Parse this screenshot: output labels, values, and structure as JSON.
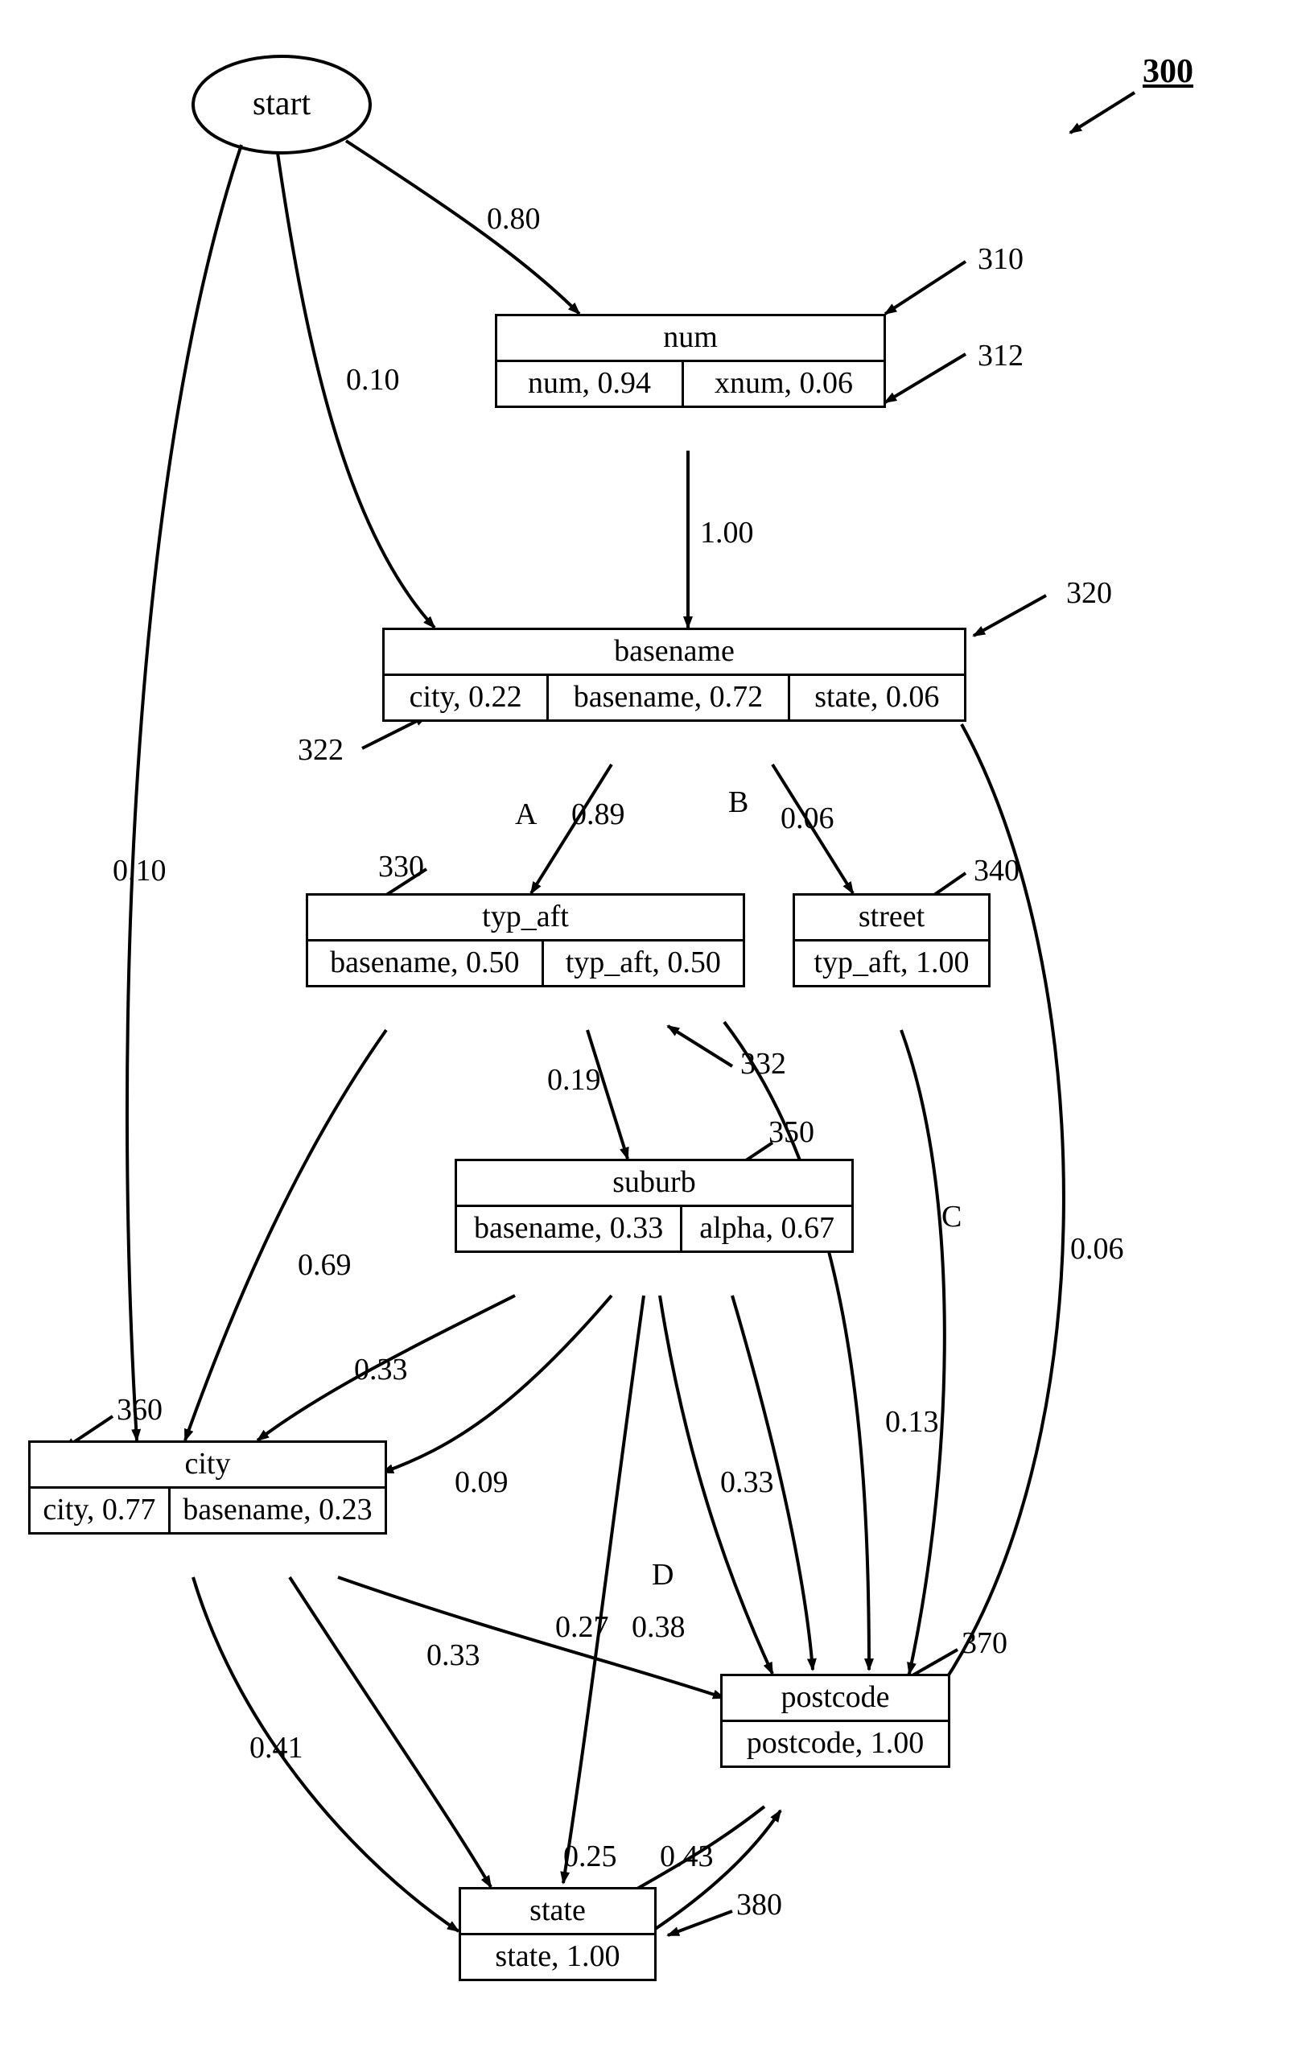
{
  "refs": {
    "r300": "300",
    "r310": "310",
    "r312": "312",
    "r320": "320",
    "r322": "322",
    "r330": "330",
    "r332": "332",
    "r340": "340",
    "r350": "350",
    "r360": "360",
    "r370": "370",
    "r380": "380"
  },
  "nodes": {
    "start": {
      "label": "start"
    },
    "num": {
      "label": "num",
      "cells": [
        "num, 0.94",
        "xnum, 0.06"
      ]
    },
    "basename": {
      "label": "basename",
      "cells": [
        "city, 0.22",
        "basename, 0.72",
        "state, 0.06"
      ]
    },
    "typaft": {
      "label": "typ_aft",
      "cells": [
        "basename, 0.50",
        "typ_aft, 0.50"
      ]
    },
    "street": {
      "label": "street",
      "cells": [
        "typ_aft, 1.00"
      ]
    },
    "suburb": {
      "label": "suburb",
      "cells": [
        "basename, 0.33",
        "alpha, 0.67"
      ]
    },
    "city": {
      "label": "city",
      "cells": [
        "city, 0.77",
        "basename, 0.23"
      ]
    },
    "postcode": {
      "label": "postcode",
      "cells": [
        "postcode, 1.00"
      ]
    },
    "state": {
      "label": "state",
      "cells": [
        "state, 1.00"
      ]
    }
  },
  "letters": {
    "A": "A",
    "B": "B",
    "C": "C",
    "D": "D"
  },
  "edges": {
    "start_num": "0.80",
    "start_basename": "0.10",
    "start_city": "0.10",
    "num_basename": "1.00",
    "basename_typaft": "0.89",
    "basename_street": "0.06",
    "basename_postcode": "0.06",
    "typaft_suburb": "0.19",
    "typaft_city": "0.69",
    "typaft_postcode": "0.13",
    "suburb_city_a": "0.33",
    "suburb_city_b": "0.09",
    "suburb_postcode": "0.33",
    "suburb_state": "0.27",
    "city_postcode": "0.38",
    "city_state_a": "0.33",
    "city_state_b": "0.41",
    "postcode_state": "0.25",
    "state_postcode": "0.43"
  },
  "chart_data": {
    "type": "state-diagram",
    "title": "300",
    "nodes": [
      {
        "id": "start",
        "emissions": []
      },
      {
        "id": "num",
        "ref": 310,
        "emissions": [
          {
            "sym": "num",
            "p": 0.94
          },
          {
            "sym": "xnum",
            "p": 0.06
          }
        ],
        "emissions_ref": 312
      },
      {
        "id": "basename",
        "ref": 320,
        "emissions": [
          {
            "sym": "city",
            "p": 0.22
          },
          {
            "sym": "basename",
            "p": 0.72
          },
          {
            "sym": "state",
            "p": 0.06
          }
        ],
        "emissions_ref": 322
      },
      {
        "id": "typ_aft",
        "ref": 330,
        "emissions": [
          {
            "sym": "basename",
            "p": 0.5
          },
          {
            "sym": "typ_aft",
            "p": 0.5
          }
        ],
        "emissions_ref": 332
      },
      {
        "id": "street",
        "ref": 340,
        "emissions": [
          {
            "sym": "typ_aft",
            "p": 1.0
          }
        ]
      },
      {
        "id": "suburb",
        "ref": 350,
        "emissions": [
          {
            "sym": "basename",
            "p": 0.33
          },
          {
            "sym": "alpha",
            "p": 0.67
          }
        ]
      },
      {
        "id": "city",
        "ref": 360,
        "emissions": [
          {
            "sym": "city",
            "p": 0.77
          },
          {
            "sym": "basename",
            "p": 0.23
          }
        ]
      },
      {
        "id": "postcode",
        "ref": 370,
        "emissions": [
          {
            "sym": "postcode",
            "p": 1.0
          }
        ]
      },
      {
        "id": "state",
        "ref": 380,
        "emissions": [
          {
            "sym": "state",
            "p": 1.0
          }
        ]
      }
    ],
    "edges": [
      {
        "from": "start",
        "to": "num",
        "p": 0.8
      },
      {
        "from": "start",
        "to": "basename",
        "p": 0.1
      },
      {
        "from": "start",
        "to": "city",
        "p": 0.1
      },
      {
        "from": "num",
        "to": "basename",
        "p": 1.0
      },
      {
        "from": "basename",
        "to": "typ_aft",
        "p": 0.89,
        "tag": "A"
      },
      {
        "from": "basename",
        "to": "street",
        "p": 0.06,
        "tag": "B"
      },
      {
        "from": "basename",
        "to": "postcode",
        "p": 0.06
      },
      {
        "from": "typ_aft",
        "to": "suburb",
        "p": 0.19
      },
      {
        "from": "typ_aft",
        "to": "city",
        "p": 0.69
      },
      {
        "from": "typ_aft",
        "to": "postcode",
        "p": 0.13
      },
      {
        "from": "street",
        "to": "postcode",
        "tag": "C"
      },
      {
        "from": "suburb",
        "to": "city",
        "p": 0.33
      },
      {
        "from": "suburb",
        "to": "city",
        "p": 0.09
      },
      {
        "from": "suburb",
        "to": "postcode",
        "p": 0.33
      },
      {
        "from": "suburb",
        "to": "state",
        "p": 0.27
      },
      {
        "from": "city",
        "to": "postcode",
        "p": 0.38,
        "tag": "D"
      },
      {
        "from": "city",
        "to": "state",
        "p": 0.33
      },
      {
        "from": "city",
        "to": "state",
        "p": 0.41
      },
      {
        "from": "postcode",
        "to": "state",
        "p": 0.25
      },
      {
        "from": "state",
        "to": "postcode",
        "p": 0.43
      }
    ]
  }
}
